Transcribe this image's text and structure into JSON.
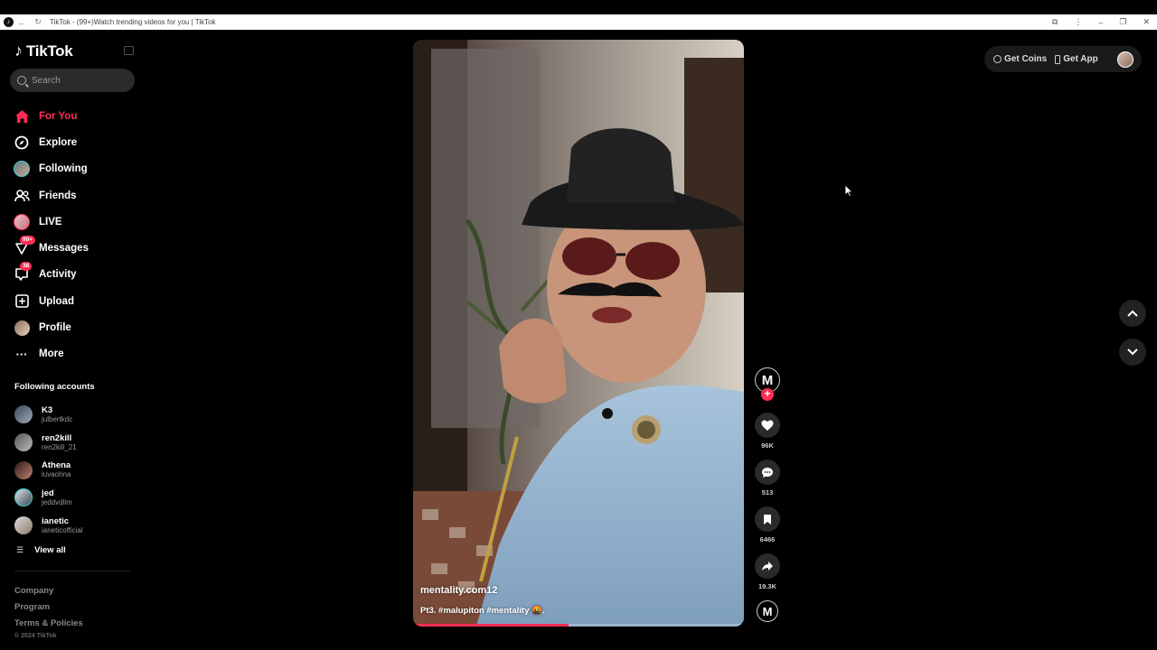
{
  "browser": {
    "tab_title": "TikTok - (99+)Watch trending videos for you | TikTok"
  },
  "sidebar": {
    "logo": "TikTok",
    "search_placeholder": "Search",
    "nav": [
      {
        "label": "For You",
        "icon": "home-icon",
        "active": true
      },
      {
        "label": "Explore",
        "icon": "compass-icon"
      },
      {
        "label": "Following",
        "icon": "following-avatar"
      },
      {
        "label": "Friends",
        "icon": "friends-icon"
      },
      {
        "label": "LIVE",
        "icon": "live-avatar"
      },
      {
        "label": "Messages",
        "icon": "messages-icon",
        "badge": "99+"
      },
      {
        "label": "Activity",
        "icon": "activity-icon",
        "badge": "38"
      },
      {
        "label": "Upload",
        "icon": "upload-icon"
      },
      {
        "label": "Profile",
        "icon": "profile-avatar"
      },
      {
        "label": "More",
        "icon": "more-icon"
      }
    ],
    "following_title": "Following accounts",
    "following": [
      {
        "name": "K3",
        "handle": "julbertkdc"
      },
      {
        "name": "ren2kill",
        "handle": "ren2kill_21"
      },
      {
        "name": "Athena",
        "handle": "luvaohna"
      },
      {
        "name": "jed",
        "handle": "jeddvdlim"
      },
      {
        "name": "ianetic",
        "handle": "ianeticofficial"
      }
    ],
    "view_all": "View all",
    "footer": {
      "company": "Company",
      "program": "Program",
      "terms": "Terms & Policies",
      "copyright": "© 2024 TikTok"
    }
  },
  "video": {
    "author": "mentality.com12",
    "caption": "Pt3. #malupiton #mentality 🤬.",
    "progress": 0.47
  },
  "actions": {
    "creator_initial": "M",
    "likes": "96K",
    "comments": "513",
    "saves": "6466",
    "shares": "19.3K",
    "sound_initial": "M"
  },
  "topbar": {
    "get_coins": "Get Coins",
    "get_app": "Get App"
  },
  "colors": {
    "accent": "#fe2c55",
    "background": "#000000"
  }
}
